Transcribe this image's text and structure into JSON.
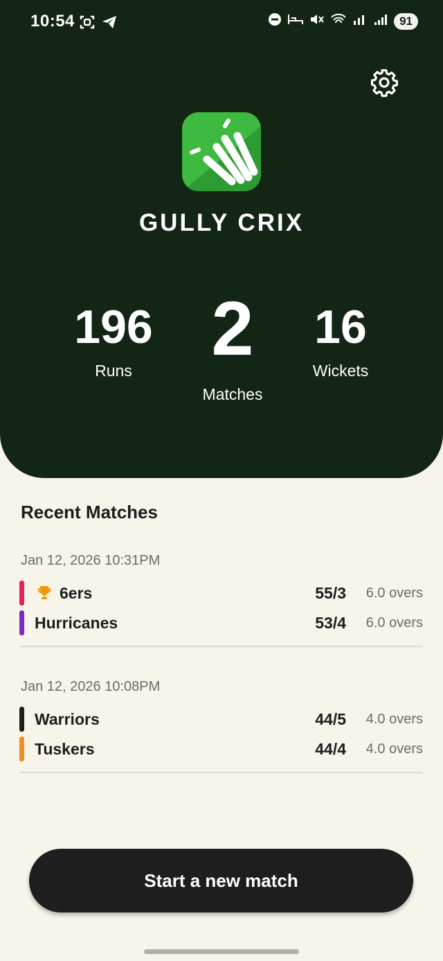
{
  "status_bar": {
    "time": "10:54",
    "battery": "91",
    "left_icons": [
      "screenshot-icon",
      "telegram-icon"
    ],
    "right_icons": [
      "dnd-icon",
      "sleep-icon",
      "mute-icon",
      "wifi-icon",
      "signal-icon",
      "signal-icon"
    ]
  },
  "header": {
    "app_title": "GULLY CRIX",
    "settings_icon": "gear-icon",
    "logo_icon": "app-logo-icon"
  },
  "stats": {
    "runs": {
      "value": "196",
      "label": "Runs"
    },
    "matches": {
      "value": "2",
      "label": "Matches"
    },
    "wickets": {
      "value": "16",
      "label": "Wickets"
    }
  },
  "recent": {
    "title": "Recent Matches",
    "matches": [
      {
        "date": "Jan 12, 2026 10:31PM",
        "teams": [
          {
            "name": "6ers",
            "score": "55/3",
            "overs": "6.0 overs",
            "color": "#e0245e",
            "winner": true
          },
          {
            "name": "Hurricanes",
            "score": "53/4",
            "overs": "6.0 overs",
            "color": "#7b2cbf",
            "winner": false
          }
        ]
      },
      {
        "date": "Jan 12, 2026 10:08PM",
        "teams": [
          {
            "name": "Warriors",
            "score": "44/5",
            "overs": "4.0 overs",
            "color": "#1e1e1e",
            "winner": false
          },
          {
            "name": "Tuskers",
            "score": "44/4",
            "overs": "4.0 overs",
            "color": "#f28c28",
            "winner": false
          }
        ]
      }
    ]
  },
  "actions": {
    "start_label": "Start a new match"
  },
  "colors": {
    "hero_bg": "#132515",
    "page_bg": "#f7f4e9",
    "logo_green": "#3dba3f",
    "trophy": "#f29900"
  }
}
